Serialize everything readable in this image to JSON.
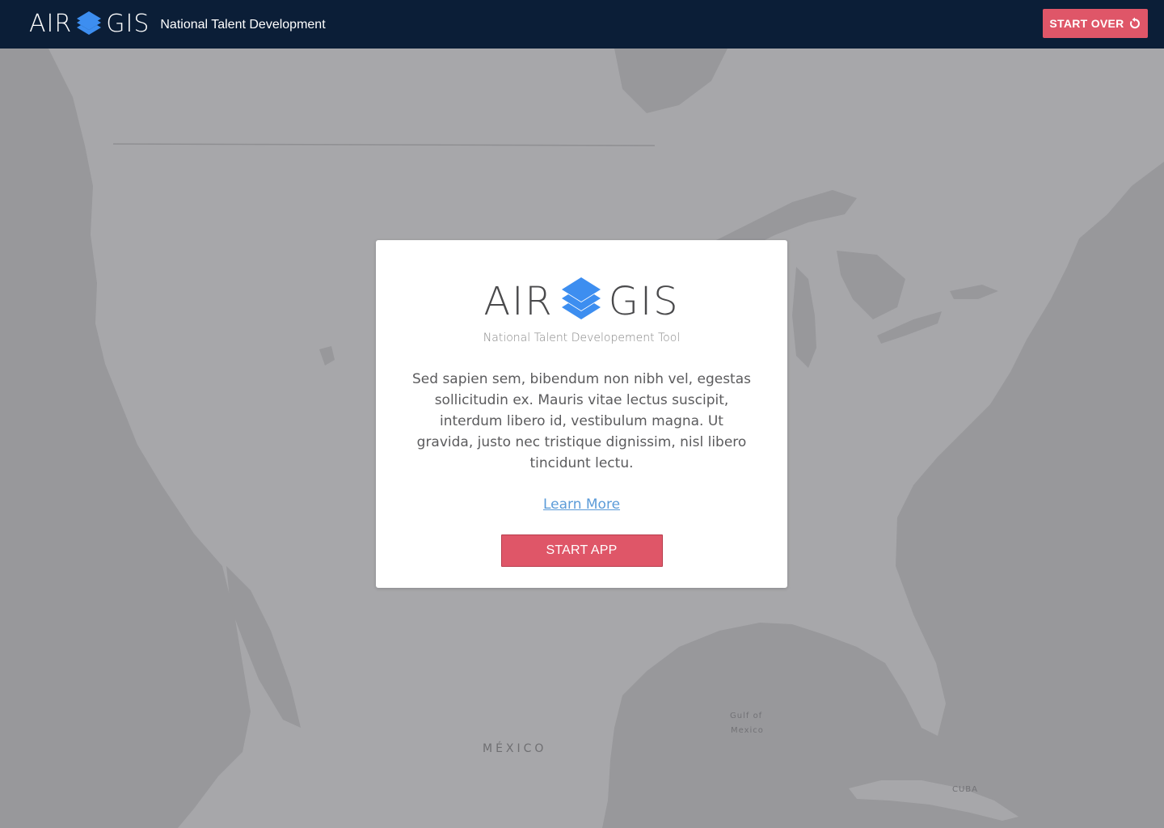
{
  "header": {
    "brand_left": "AIR",
    "brand_right": "GIS",
    "subtitle": "National Talent Development",
    "start_over_label": "START OVER",
    "start_over_icon": "refresh-icon"
  },
  "modal": {
    "brand_left": "AIR",
    "brand_right": "GIS",
    "subtitle": "National Talent Developement Tool",
    "body": "Sed sapien sem, bibendum non nibh vel, egestas sollicitudin ex. Mauris vitae lectus suscipit, interdum libero id, vestibulum magna. Ut gravida, justo nec tristique dignissim, nisl libero tincidunt lectu.",
    "learn_more_label": "Learn More",
    "start_app_label": "START APP"
  },
  "map": {
    "labels": {
      "mexico": "MÉXICO",
      "gulf_line1": "Gulf of",
      "gulf_line2": "Mexico",
      "cuba": "CUBA"
    }
  },
  "colors": {
    "header_bg": "#0b1e37",
    "accent_red": "#df5668",
    "logo_blue": "#3d8ef0",
    "link_blue": "#5b9bd8",
    "land": "#a7a7aa",
    "water": "#98989b"
  }
}
